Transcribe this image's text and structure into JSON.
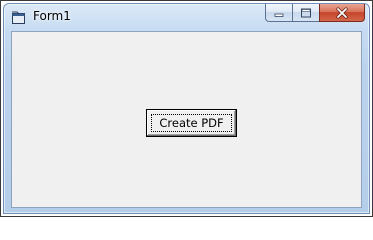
{
  "window": {
    "title": "Form1",
    "icon": "form-icon",
    "caption_buttons": [
      "minimize-icon",
      "maximize-icon",
      "close-icon"
    ],
    "close_color": "#c4442a"
  },
  "form": {
    "button_label": "Create PDF",
    "background": "#f0f0f0"
  }
}
